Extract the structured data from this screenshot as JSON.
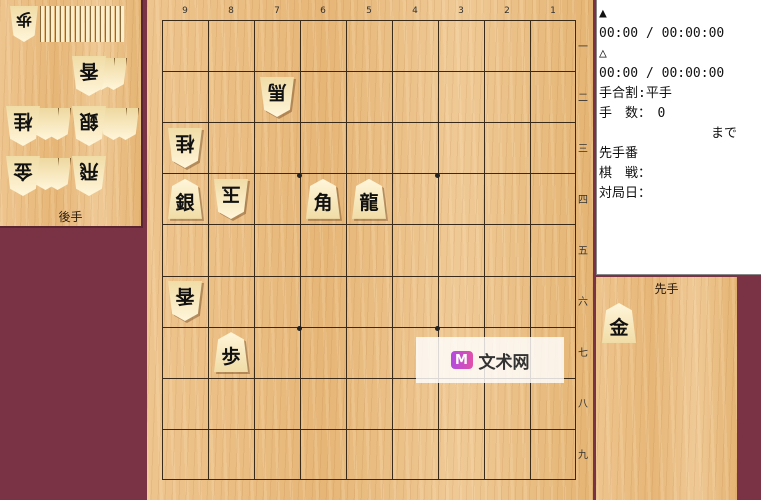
{
  "gote_stand": {
    "label": "後手",
    "pieces": [
      {
        "char": "歩",
        "count_visible": 1
      },
      {
        "char": "香",
        "count_visible": 3
      },
      {
        "char": "桂",
        "count_visible": 3
      },
      {
        "char": "銀",
        "count_visible": 3
      },
      {
        "char": "金",
        "count_visible": 3
      },
      {
        "char": "飛",
        "count_visible": 1
      }
    ]
  },
  "board": {
    "file_labels": [
      "9",
      "8",
      "7",
      "6",
      "5",
      "4",
      "3",
      "2",
      "1"
    ],
    "rank_labels": [
      "一",
      "二",
      "三",
      "四",
      "五",
      "六",
      "七",
      "八",
      "九"
    ],
    "pieces": [
      {
        "char": "馬",
        "file": 7,
        "rank": 2,
        "side": "gote"
      },
      {
        "char": "桂",
        "file": 9,
        "rank": 3,
        "side": "gote"
      },
      {
        "char": "銀",
        "file": 9,
        "rank": 4,
        "side": "sente"
      },
      {
        "char": "玉",
        "file": 8,
        "rank": 4,
        "side": "gote"
      },
      {
        "char": "角",
        "file": 6,
        "rank": 4,
        "side": "sente"
      },
      {
        "char": "龍",
        "file": 5,
        "rank": 4,
        "side": "sente"
      },
      {
        "char": "香",
        "file": 9,
        "rank": 6,
        "side": "gote"
      },
      {
        "char": "歩",
        "file": 8,
        "rank": 7,
        "side": "sente"
      }
    ]
  },
  "info": {
    "sente_mark": "▲",
    "sente_time": "00:00 / 00:00:00",
    "gote_mark": "△",
    "gote_time": "00:00 / 00:00:00",
    "handicap": "手合割:平手",
    "move_count": "手　数：　0",
    "made": "まで",
    "turn": "先手番",
    "kisen": "棋　戦：",
    "date": "対局日："
  },
  "sente_stand": {
    "label": "先手",
    "pieces": [
      {
        "char": "金",
        "count": 1
      }
    ]
  },
  "watermark": {
    "logo": "M",
    "text": "文术网"
  },
  "colors": {
    "background": "#7a3344",
    "board": "#ecbf86",
    "info_bg": "#ffffff"
  }
}
